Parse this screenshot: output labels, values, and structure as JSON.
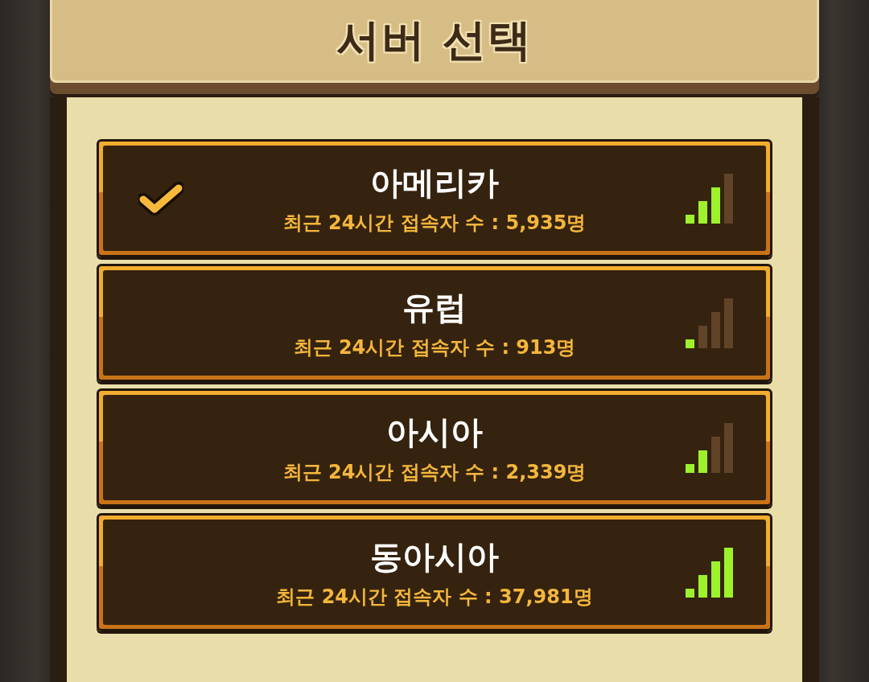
{
  "title": "서버 선택",
  "servers": [
    {
      "name": "아메리카",
      "info": "최근 24시간 접속자 수 : 5,935명",
      "selected": true,
      "level": 0.75
    },
    {
      "name": "유럽",
      "info": "최근 24시간 접속자 수 : 913명",
      "selected": false,
      "level": 0.25
    },
    {
      "name": "아시아",
      "info": "최근 24시간 접속자 수 : 2,339명",
      "selected": false,
      "level": 0.5
    },
    {
      "name": "동아시아",
      "info": "최근 24시간 접속자 수 : 37,981명",
      "selected": false,
      "level": 1
    }
  ]
}
